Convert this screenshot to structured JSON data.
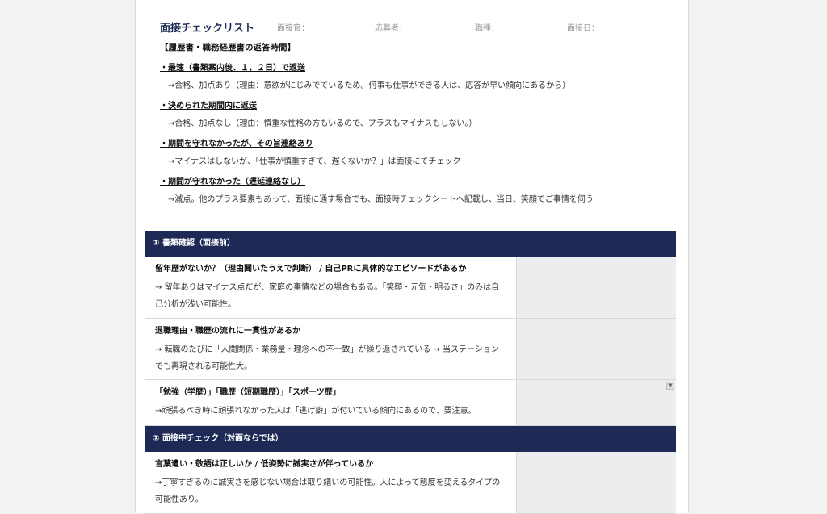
{
  "header": {
    "title": "面接チェックリスト",
    "interviewer_label": "面接官：",
    "applicant_label": "応募者：",
    "job_label": "職種：",
    "date_label": "面接日："
  },
  "intro": {
    "heading": "【履歴書・職務経歴書の返答時間】",
    "items": [
      {
        "sub": "・最速（書類案内後、１，２日）で返送",
        "desc": "→合格、加点あり（理由：意欲がにじみでているため。何事も仕事ができる人は、応答が早い傾向にあるから）"
      },
      {
        "sub": "・決められた期間内に返送",
        "desc": "→合格、加点なし（理由：慎重な性格の方もいるので、プラスもマイナスもしない。）"
      },
      {
        "sub": "・期間を守れなかったが、その旨連絡あり",
        "desc": "→マイナスはしないが、「仕事が慎重すぎて、遅くないか？」は面接にてチェック"
      },
      {
        "sub": "・期間が守れなかった（遅延連絡なし）",
        "desc": "→減点。他のプラス要素もあって、面接に通す場合でも、面接時チェックシートへ記載し、当日、笑顔でご事情を伺う"
      }
    ]
  },
  "sections": [
    {
      "title": "① 書類確認（面接前）",
      "rows": [
        {
          "q": "留年歴がないか？（理由聞いたうえで判断） / 自己PRに具体的なエピソードがあるか",
          "d": "→ 留年ありはマイナス点だが、家庭の事情などの場合もある。「笑顔・元気・明るさ」のみは自己分析が浅い可能性。"
        },
        {
          "q": "退職理由・職歴の流れに一貫性があるか",
          "d": "→ 転職のたびに「人間関係・業務量・理念への不一致」が繰り返されている → 当ステーションでも再現される可能性大。"
        },
        {
          "q": "「勉強（学歴）」「職歴（短期職歴）」「スポーツ歴」",
          "d": "→頑張るべき時に頑張れなかった人は「逃げ癖」が付いている傾向にあるので、要注意。"
        }
      ]
    },
    {
      "title": "② 面接中チェック（対面ならでは）",
      "rows": [
        {
          "q": "言葉遣い・敬語は正しいか / 低姿勢に誠実さが伴っているか",
          "d": "→丁寧すぎるのに誠実さを感じない場合は取り繕いの可能性。人によって態度を変えるタイプの可能性あり。"
        }
      ]
    }
  ]
}
